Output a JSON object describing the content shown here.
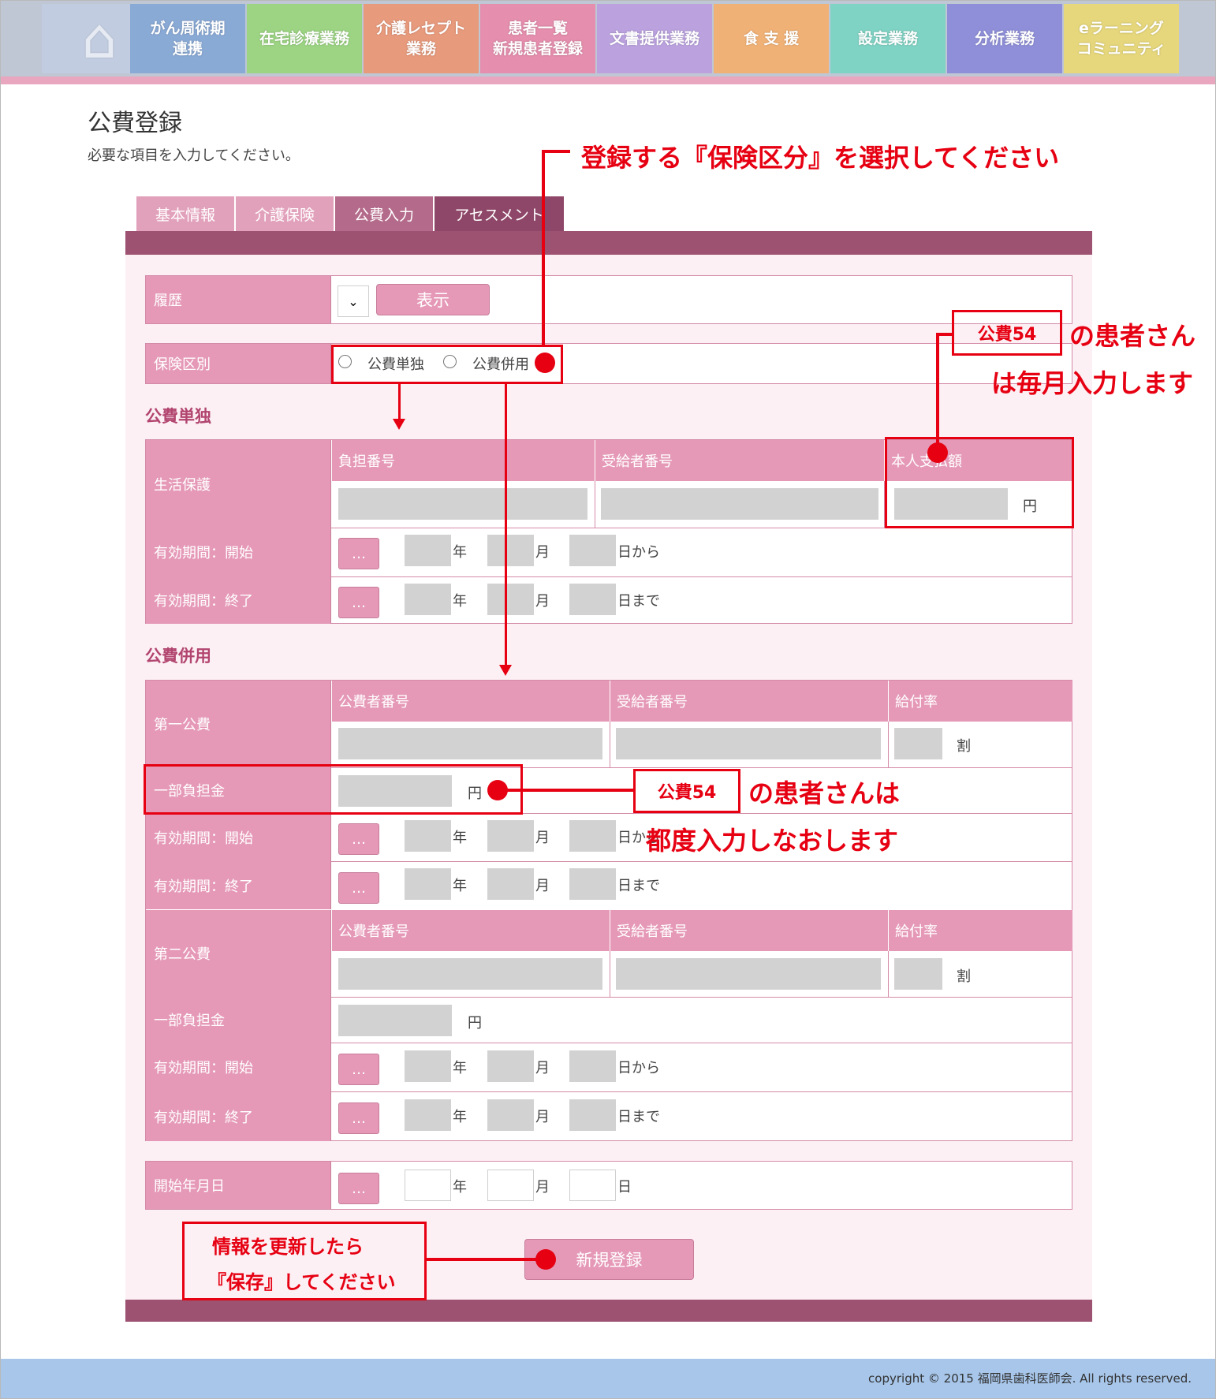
{
  "nav": {
    "home_icon": "house-icon",
    "tiles": [
      "がん周術期\n連携",
      "在宅診療業務",
      "介護レセプト\n業務",
      "患者一覧\n新規患者登録",
      "文書提供業務",
      "食 支 援",
      "設定業務",
      "分析業務",
      "eラーニング\nコミュニティ"
    ],
    "colors": [
      "#8aaad6",
      "#9cd483",
      "#e89a7c",
      "#e58ead",
      "#bba2df",
      "#f0b176",
      "#7fd3c4",
      "#8f8fd9",
      "#e6d77c"
    ]
  },
  "page": {
    "title": "公費登録",
    "subtitle": "必要な項目を入力してください。"
  },
  "tabs": [
    "基本情報",
    "介護保険",
    "公費入力",
    "アセスメント"
  ],
  "history": {
    "label": "履歴",
    "show_button": "表示"
  },
  "insurance": {
    "label": "保険区別",
    "option_single": "公費単独",
    "option_combined": "公費併用"
  },
  "single": {
    "heading": "公費単独",
    "label": "生活保護",
    "col1": "負担番号",
    "col2": "受給者番号",
    "col3": "本人支払額",
    "yen": "円",
    "start_label": "有効期間：開始",
    "end_label": "有効期間：終了"
  },
  "combined": {
    "heading": "公費併用",
    "first_label": "第一公費",
    "second_label": "第二公費",
    "col1": "公費者番号",
    "col2": "受給者番号",
    "col3": "給付率",
    "rate_unit": "割",
    "partial_label": "一部負担金",
    "yen": "円",
    "start_label": "有効期間：開始",
    "end_label": "有効期間：終了"
  },
  "date": {
    "picker": "…",
    "year": "年",
    "month": "月",
    "day_from": "日から",
    "day_to": "日まで",
    "day": "日"
  },
  "start_date": {
    "label": "開始年月日"
  },
  "register_button": "新規登録",
  "annotations": {
    "select_type": "登録する『保険区分』を選択してください",
    "kohi54": "公費54",
    "monthly1": "の患者さん",
    "monthly2": "は毎月入力します",
    "each1": "の患者さんは",
    "each2": "都度入力しなおします",
    "save1": "情報を更新したら",
    "save2": "『保存』してください"
  },
  "footer": {
    "copyright": "copyright © 2015 福岡県歯科医師会. All rights reserved."
  }
}
